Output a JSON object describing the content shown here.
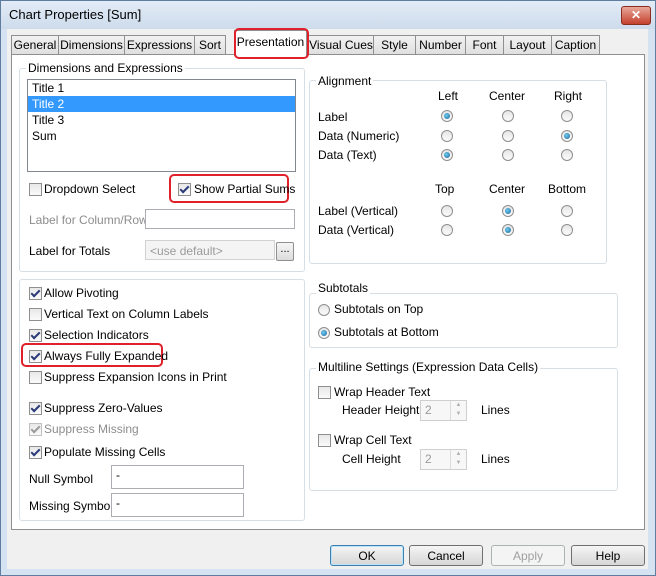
{
  "window": {
    "title": "Chart Properties [Sum]",
    "close_glyph": "✕"
  },
  "tabs": [
    {
      "label": "General"
    },
    {
      "label": "Dimensions"
    },
    {
      "label": "Expressions"
    },
    {
      "label": "Sort"
    },
    {
      "label": "Presentation",
      "active": true
    },
    {
      "label": "Visual Cues"
    },
    {
      "label": "Style"
    },
    {
      "label": "Number"
    },
    {
      "label": "Font"
    },
    {
      "label": "Layout"
    },
    {
      "label": "Caption"
    }
  ],
  "dims_expr": {
    "group_title": "Dimensions and Expressions",
    "items": [
      "Title 1",
      "Title 2",
      "Title 3",
      "Sum"
    ],
    "selected": "Title 2",
    "dropdown_select": {
      "label": "Dropdown Select",
      "checked": false
    },
    "show_partial_sums": {
      "label": "Show Partial Sums",
      "checked": true
    },
    "label_column_row": {
      "label": "Label for Column/Row",
      "value": ""
    },
    "label_totals": {
      "label": "Label for Totals",
      "placeholder": "<use default>",
      "button": "..."
    }
  },
  "alignment": {
    "group_title": "Alignment",
    "col_headers": [
      "Left",
      "Center",
      "Right"
    ],
    "rows": [
      {
        "label": "Label",
        "selected": "Left"
      },
      {
        "label": "Data (Numeric)",
        "selected": "Right"
      },
      {
        "label": "Data (Text)",
        "selected": "Left"
      }
    ],
    "vcol_headers": [
      "Top",
      "Center",
      "Bottom"
    ],
    "vrows": [
      {
        "label": "Label (Vertical)",
        "selected": "Center"
      },
      {
        "label": "Data (Vertical)",
        "selected": "Center"
      }
    ]
  },
  "options": [
    {
      "label": "Allow Pivoting",
      "checked": true,
      "enabled": true
    },
    {
      "label": "Vertical Text on Column Labels",
      "checked": false,
      "enabled": true
    },
    {
      "label": "Selection Indicators",
      "checked": true,
      "enabled": true
    },
    {
      "label": "Always Fully Expanded",
      "checked": true,
      "enabled": true
    },
    {
      "label": "Suppress Expansion Icons in Print",
      "checked": false,
      "enabled": true
    },
    {
      "label": "Suppress Zero-Values",
      "checked": true,
      "enabled": true
    },
    {
      "label": "Suppress Missing",
      "checked": true,
      "enabled": false
    },
    {
      "label": "Populate Missing Cells",
      "checked": true,
      "enabled": true
    }
  ],
  "symbols": {
    "null_label": "Null Symbol",
    "null_value": "-",
    "missing_label": "Missing Symbol",
    "missing_value": "-"
  },
  "subtotals": {
    "group_title": "Subtotals",
    "options": [
      "Subtotals on Top",
      "Subtotals at Bottom"
    ],
    "selected": "Subtotals at Bottom"
  },
  "multiline": {
    "group_title": "Multiline Settings (Expression Data Cells)",
    "wrap_header": {
      "label": "Wrap Header Text",
      "checked": false
    },
    "header_height": {
      "label": "Header Height",
      "value": "2",
      "unit": "Lines"
    },
    "wrap_cell": {
      "label": "Wrap Cell Text",
      "checked": false
    },
    "cell_height": {
      "label": "Cell Height",
      "value": "2",
      "unit": "Lines"
    }
  },
  "buttons": {
    "ok": "OK",
    "cancel": "Cancel",
    "apply": "Apply",
    "help": "Help"
  },
  "colors": {
    "highlight": "#e0202a",
    "selection": "#3399ff",
    "titlebar": "#cddbeb"
  }
}
